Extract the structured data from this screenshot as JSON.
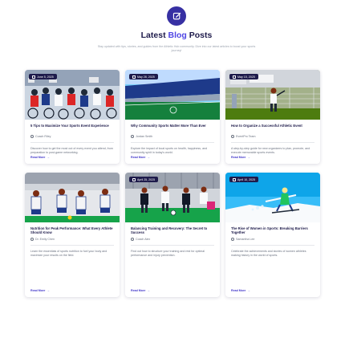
{
  "header": {
    "title_main": "Latest",
    "title_accent": "Blog",
    "title_end": "Posts",
    "subtitle": "Stay updated with tips, stories, and guides from the Athletic Hub community. Dive into our latest articles to boost your sports journey!"
  },
  "posts": [
    {
      "date": "June 5, 2025",
      "title": "5 Tips to Maximize Your Sports Event Experience",
      "author": "Coach Riley",
      "excerpt": "Discover how to get the most out of every event you attend, from preparation to post-game networking.",
      "read_more": "Read More"
    },
    {
      "date": "May 28, 2025",
      "title": "Why Community Sports Matter More Than Ever",
      "author": "Jordan Smith",
      "excerpt": "Explore the impact of local sports on health, happiness, and community spirit in today's world.",
      "read_more": "Read More"
    },
    {
      "date": "May 15, 2025",
      "title": "How to Organize a Successful Athletic Event",
      "author": "EventPro Team",
      "excerpt": "A step-by-step guide for new organizers to plan, promote, and execute memorable sports events.",
      "read_more": "Read More"
    },
    {
      "date": "",
      "title": "Nutrition for Peak Performance: What Every Athlete Should Know",
      "author": "Dr. Emily Chen",
      "excerpt": "Learn the essentials of sports nutrition to fuel your body and maximize your results on the field.",
      "read_more": "Read More"
    },
    {
      "date": "April 25, 2025",
      "title": "Balancing Training and Recovery: The Secret to Success",
      "author": "Coach Alex",
      "excerpt": "Find out how to structure your training and rest for optimal performance and injury prevention.",
      "read_more": "Read More"
    },
    {
      "date": "April 10, 2025",
      "title": "The Rise of Women in Sports: Breaking Barriers Together",
      "author": "Samantha Lee",
      "excerpt": "Celebrate the achievements and stories of women athletes making history in the world of sports.",
      "read_more": "Read More"
    }
  ],
  "colors": {
    "primary": "#3730a3",
    "accent": "#4f46e5",
    "dark": "#1e1b4b"
  }
}
